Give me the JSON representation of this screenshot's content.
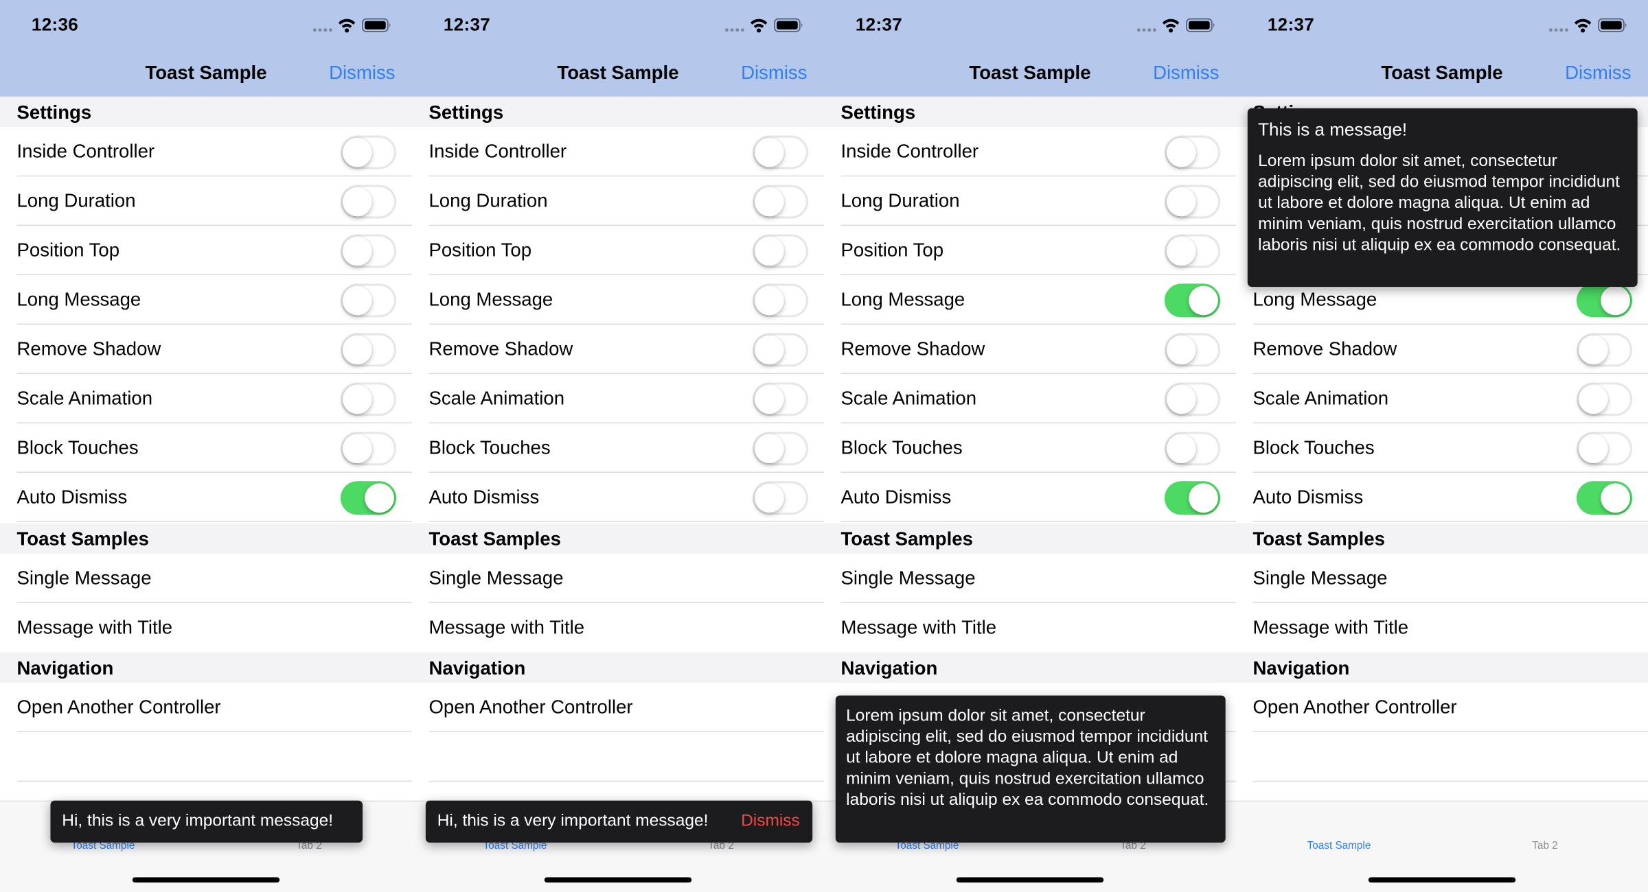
{
  "status_times": [
    "12:36",
    "12:37",
    "12:37",
    "12:37"
  ],
  "nav": {
    "title": "Toast Sample",
    "dismiss": "Dismiss"
  },
  "sections": {
    "settings": "Settings",
    "toast_samples": "Toast Samples",
    "navigation": "Navigation"
  },
  "settings_labels": [
    "Inside Controller",
    "Long Duration",
    "Position Top",
    "Long Message",
    "Remove Shadow",
    "Scale Animation",
    "Block Touches",
    "Auto Dismiss"
  ],
  "toggle_states": [
    [
      false,
      false,
      false,
      false,
      false,
      false,
      false,
      true
    ],
    [
      false,
      false,
      false,
      false,
      false,
      false,
      false,
      false
    ],
    [
      false,
      false,
      false,
      true,
      false,
      false,
      false,
      true
    ],
    [
      true,
      false,
      true,
      true,
      false,
      false,
      false,
      true
    ]
  ],
  "toast_sample_labels": [
    "Single Message",
    "Message with Title"
  ],
  "navigation_labels": [
    "Open Another Controller"
  ],
  "tabs": [
    "Toast Sample",
    "Tab 2"
  ],
  "toasts": {
    "short_message": "Hi, this is a very important message!",
    "dismiss": "Dismiss",
    "title": "This is a message!",
    "long_message": "Lorem ipsum dolor sit amet, consectetur adipiscing elit, sed do eiusmod tempor incididunt ut labore et dolore magna aliqua. Ut enim ad minim veniam, quis nostrud exercitation ullamco laboris nisi ut aliquip ex ea commodo consequat."
  },
  "colors": {
    "nav_background": "#b5c8ec",
    "tint": "#2f7ff6",
    "switch_on": "#4cd964",
    "toast_background": "#1c1c1e",
    "toast_dismiss": "#f44848"
  },
  "icons": [
    "cellular-signal-icon",
    "wifi-icon",
    "battery-icon"
  ]
}
